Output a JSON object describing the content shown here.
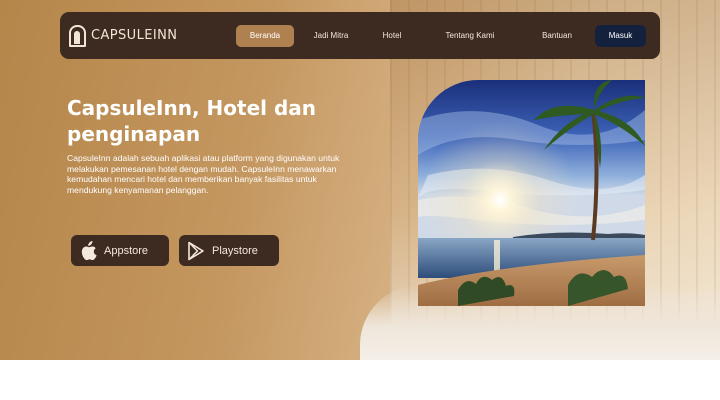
{
  "brand": {
    "name": "CAPSULEINN"
  },
  "nav": {
    "items": [
      {
        "label": "Beranda",
        "active": true
      },
      {
        "label": "Jadi Mitra",
        "active": false
      },
      {
        "label": "Hotel",
        "active": false
      },
      {
        "label": "Tentang Kami",
        "active": false
      },
      {
        "label": "Bantuan",
        "active": false
      }
    ],
    "login_label": "Masuk"
  },
  "hero": {
    "title": "CapsuleInn, Hotel dan penginapan",
    "description": "CapsuleInn adalah sebuah aplikasi atau platform yang digunakan untuk melakukan pemesanan hotel dengan mudah. CapsuleInn menawarkan kemudahan mencari hotel dan memberikan banyak fasilitas untuk mendukung kenyamanan pelanggan."
  },
  "store_buttons": [
    {
      "label": "Appstore",
      "icon": "apple-icon"
    },
    {
      "label": "Playstore",
      "icon": "play-store-icon"
    }
  ],
  "colors": {
    "navbar": "#3d2a20",
    "nav_active": "#b08150",
    "login_button": "#14213d"
  }
}
